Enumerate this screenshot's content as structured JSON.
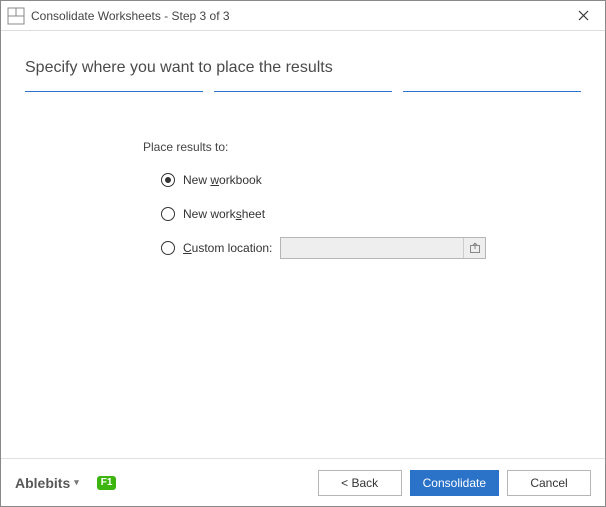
{
  "window": {
    "title": "Consolidate Worksheets - Step 3 of 3"
  },
  "heading": "Specify where you want to place the results",
  "options": {
    "heading": "Place results to:",
    "items": [
      {
        "label_pre": "New ",
        "label_ul": "w",
        "label_post": "orkbook",
        "checked": true
      },
      {
        "label_pre": "New work",
        "label_ul": "s",
        "label_post": "heet",
        "checked": false
      },
      {
        "label_pre": "",
        "label_ul": "C",
        "label_post": "ustom location:",
        "checked": false
      }
    ],
    "custom_location_value": ""
  },
  "footer": {
    "brand": "Ablebits",
    "help_badge": "F1",
    "back_label": "<  Back",
    "primary_label": "Consolidate",
    "cancel_label": "Cancel"
  }
}
